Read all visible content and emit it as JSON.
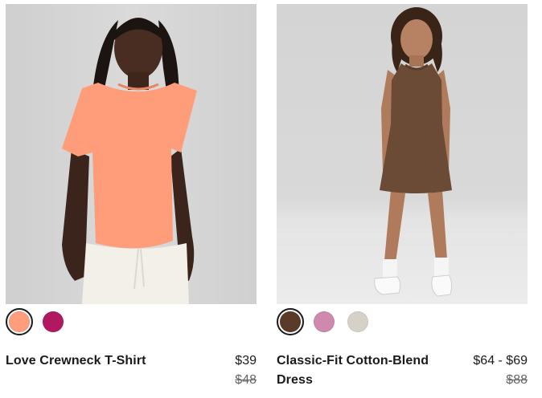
{
  "products": [
    {
      "name": "Love Crewneck T-Shirt",
      "name_lines": [
        "Love Crewneck T-Shirt"
      ],
      "price": "$39",
      "original_price": "$48",
      "colors": [
        {
          "name": "coral",
          "hex": "#FF9D7C",
          "selected": true
        },
        {
          "name": "magenta",
          "hex": "#B2185F",
          "selected": false
        }
      ]
    },
    {
      "name": "Classic-Fit Cotton-Blend Dress",
      "name_lines": [
        "Classic-Fit Cotton-Blend",
        "Dress"
      ],
      "price": "$64 - $69",
      "original_price": "$88",
      "colors": [
        {
          "name": "brown",
          "hex": "#5A3B2A",
          "selected": true
        },
        {
          "name": "mauve",
          "hex": "#CF88AE",
          "selected": false
        },
        {
          "name": "bone",
          "hex": "#D6D1C8",
          "selected": false
        }
      ]
    }
  ]
}
